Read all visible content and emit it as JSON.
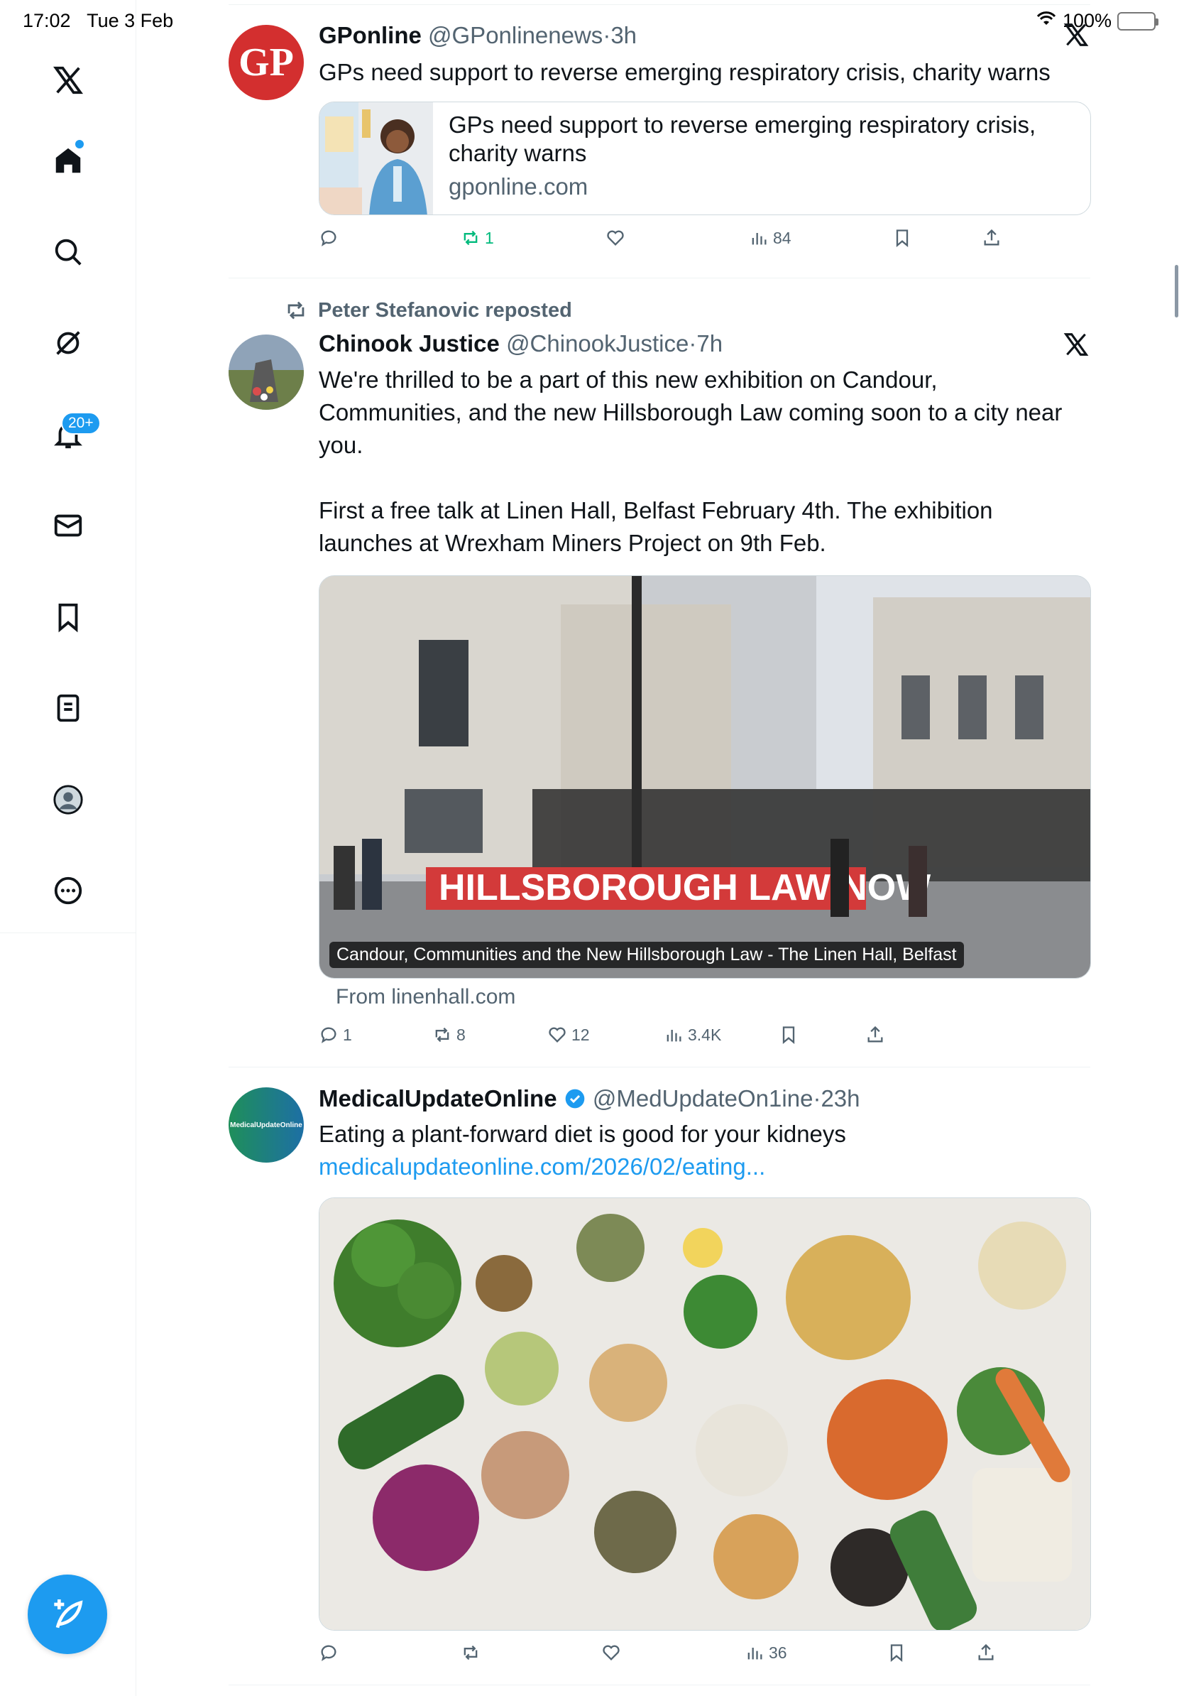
{
  "status_bar": {
    "time": "17:02",
    "date": "Tue 3 Feb",
    "battery": "100%"
  },
  "sidebar": {
    "items": [
      {
        "name": "x-logo"
      },
      {
        "name": "home"
      },
      {
        "name": "search"
      },
      {
        "name": "grok"
      },
      {
        "name": "notifications",
        "badge": "20+"
      },
      {
        "name": "messages"
      },
      {
        "name": "bookmarks"
      },
      {
        "name": "lists"
      },
      {
        "name": "profile"
      },
      {
        "name": "more"
      }
    ]
  },
  "tweets": [
    {
      "name": "GPonline",
      "handle": "@GPonlinenews",
      "time": "3h",
      "avatar_text": "GP",
      "text": "GPs need support to reverse emerging respiratory crisis, charity warns",
      "card": {
        "title": "GPs need support to reverse emerging respiratory crisis, charity warns",
        "domain": "gponline.com"
      },
      "stats": {
        "replies": "",
        "reposts": "1",
        "likes": "",
        "views": "84"
      }
    },
    {
      "reposted_by": "Peter Stefanovic reposted",
      "name": "Chinook Justice",
      "handle": "@ChinookJustice",
      "time": "7h",
      "text_line1": "We're thrilled to be a part of this new exhibition on Candour,",
      "text_line2": "Communities, and the new Hillsborough Law coming soon to a city near",
      "text_line3": "you.",
      "text_line4": "First a free talk at Linen Hall, Belfast February 4th. The exhibition",
      "text_line5": "launches at Wrexham Miners Project on 9th Feb.",
      "media_caption": "Candour, Communities and the New Hillsborough Law - The Linen Hall, Belfast",
      "banner_text": "HILLSBOROUGH LAW NOW",
      "from_link": "From linenhall.com",
      "stats": {
        "replies": "1",
        "reposts": "8",
        "likes": "12",
        "views": "3.4K"
      }
    },
    {
      "name": "MedicalUpdateOnline",
      "handle": "@MedUpdateOn1ine",
      "time": "23h",
      "avatar_text": "MedicalUpdateOnline",
      "text": "Eating a plant-forward diet is good for your kidneys",
      "url": "medicalupdateonline.com/2026/02/eating...",
      "stats": {
        "replies": "",
        "reposts": "",
        "likes": "",
        "views": "36"
      }
    }
  ],
  "colors": {
    "accent": "#1d9bf0",
    "repost_green": "#00ba7c",
    "gp_red": "#d32f2f"
  }
}
